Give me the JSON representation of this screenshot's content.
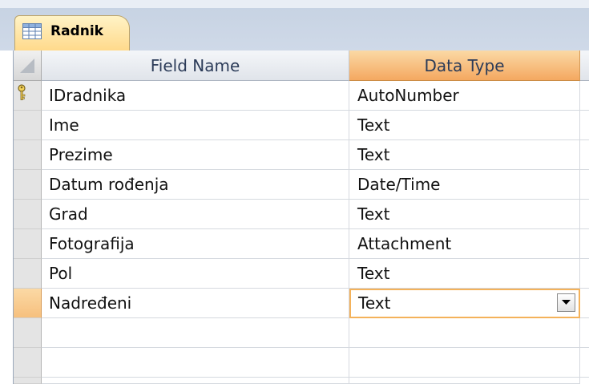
{
  "tab": {
    "label": "Radnik",
    "icon": "table-icon"
  },
  "columns": {
    "field_name": "Field Name",
    "data_type": "Data Type"
  },
  "rows": [
    {
      "name": "IDradnika",
      "type": "AutoNumber",
      "primary_key": true
    },
    {
      "name": "Ime",
      "type": "Text"
    },
    {
      "name": "Prezime",
      "type": "Text"
    },
    {
      "name": "Datum rođenja",
      "type": "Date/Time"
    },
    {
      "name": "Grad",
      "type": "Text"
    },
    {
      "name": "Fotografija",
      "type": "Attachment"
    },
    {
      "name": "Pol",
      "type": "Text"
    },
    {
      "name": "Nadređeni",
      "type": "Text",
      "current": true
    }
  ],
  "colors": {
    "accent_orange": "#f4a860",
    "tab_yellow": "#ffd98a",
    "header_text": "#2b3b58"
  }
}
